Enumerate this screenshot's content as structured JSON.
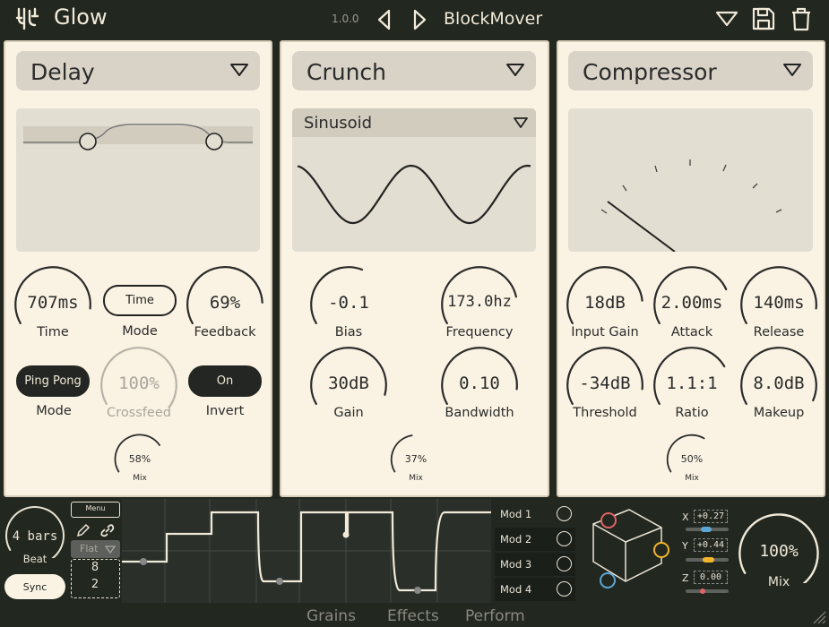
{
  "header": {
    "app_name": "Glow",
    "version": "1.0.0",
    "preset_name": "BlockMover",
    "icons": [
      "glow-logo-icon",
      "prev-preset-icon",
      "next-preset-icon",
      "preset-menu-icon",
      "save-icon",
      "trash-icon"
    ]
  },
  "delay": {
    "title": "Delay",
    "time_value": "707ms",
    "time_label": "Time",
    "mode_button": "Time",
    "mode_label": "Mode",
    "feedback_value": "69%",
    "feedback_label": "Feedback",
    "pingpong_button": "Ping Pong",
    "pingpong_label": "Mode",
    "crossfeed_value": "100%",
    "crossfeed_label": "Crossfeed",
    "invert_button": "On",
    "invert_label": "Invert",
    "mix_value": "58%",
    "mix_label": "Mix",
    "levels": {
      "time": 0.72,
      "feedback": 0.69,
      "crossfeed": 1.0,
      "mix": 0.58
    }
  },
  "crunch": {
    "title": "Crunch",
    "shape": "Sinusoid",
    "bias_value": "-0.1",
    "bias_label": "Bias",
    "frequency_value": "173.0hz",
    "frequency_label": "Frequency",
    "gain_value": "30dB",
    "gain_label": "Gain",
    "bandwidth_value": "0.10",
    "bandwidth_label": "Bandwidth",
    "mix_value": "37%",
    "mix_label": "Mix",
    "levels": {
      "bias": 0.47,
      "frequency": 0.66,
      "gain": 0.75,
      "bandwidth": 0.72,
      "mix": 0.37
    }
  },
  "compressor": {
    "title": "Compressor",
    "input_gain_value": "18dB",
    "input_gain_label": "Input Gain",
    "attack_value": "2.00ms",
    "attack_label": "Attack",
    "release_value": "140ms",
    "release_label": "Release",
    "threshold_value": "-34dB",
    "threshold_label": "Threshold",
    "ratio_value": "1.1:1",
    "ratio_label": "Ratio",
    "makeup_value": "8.0dB",
    "makeup_label": "Makeup",
    "mix_value": "50%",
    "mix_label": "Mix",
    "levels": {
      "input_gain": 0.68,
      "attack": 0.62,
      "release": 0.72,
      "threshold": 0.72,
      "ratio": 0.6,
      "makeup": 0.78,
      "mix": 0.5
    }
  },
  "sequencer": {
    "length": "4 bars",
    "beat_label": "Beat",
    "sync_button": "Sync",
    "menu_label": "Menu",
    "curve_type": "Flat",
    "numerator": "8",
    "denominator": "2"
  },
  "mods": {
    "items": [
      "Mod 1",
      "Mod 2",
      "Mod 3",
      "Mod 4"
    ]
  },
  "xyz": {
    "x_label": "X",
    "x_value": "+0.27",
    "y_label": "Y",
    "y_value": "+0.44",
    "z_label": "Z",
    "z_value": "0.00",
    "colors": {
      "x": "#5aa6d6",
      "y": "#f0b52c",
      "z": "#e06464"
    }
  },
  "master": {
    "mix_value": "100%",
    "mix_label": "Mix",
    "level": 1.0
  },
  "nav": {
    "tabs": [
      "Grains",
      "Effects",
      "Perform"
    ]
  }
}
